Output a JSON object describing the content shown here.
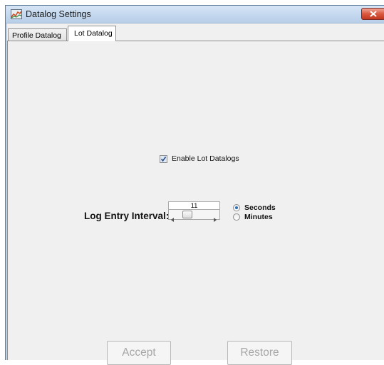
{
  "window": {
    "title": "Datalog Settings",
    "app_icon": "datalog-app-icon",
    "close_icon": "close-icon"
  },
  "tabs": [
    {
      "label": "Profile Datalog",
      "selected": false
    },
    {
      "label": "Lot Datalog",
      "selected": true
    }
  ],
  "lot_datalog": {
    "enable_checkbox": {
      "label": "Enable Lot Datalogs",
      "checked": true
    },
    "interval": {
      "label": "Log Entry Interval:",
      "value": "11",
      "slider_fraction": 0.25
    },
    "units": [
      {
        "label": "Seconds",
        "selected": true
      },
      {
        "label": "Minutes",
        "selected": false
      }
    ]
  },
  "buttons": {
    "accept_label": "Accept",
    "restore_label": "Restore",
    "enabled": false
  },
  "colors": {
    "titlebar": "#c3d7ee",
    "close_button": "#d9593f",
    "panel_background": "#f0f0f0",
    "disabled_text": "#a6a6a6"
  }
}
